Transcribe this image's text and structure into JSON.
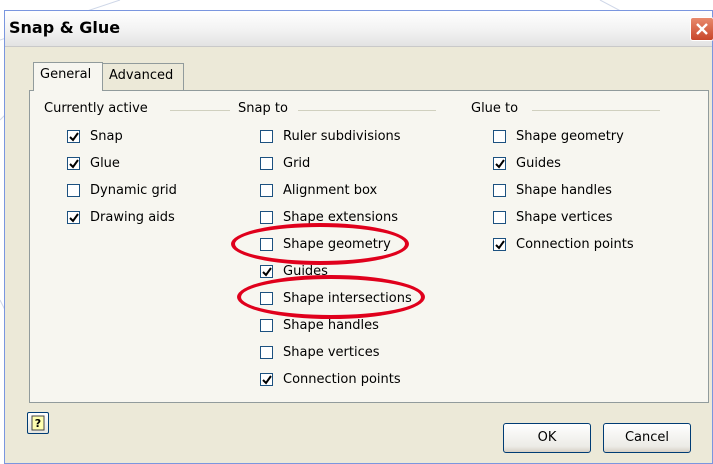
{
  "dialog": {
    "title": "Snap & Glue",
    "close_icon": "close-icon",
    "help_icon": "help-icon"
  },
  "tabs": [
    {
      "label": "General",
      "active": true
    },
    {
      "label": "Advanced",
      "active": false
    }
  ],
  "groups": {
    "currently_active": {
      "title": "Currently active",
      "items": [
        {
          "label": "Snap",
          "checked": true
        },
        {
          "label": "Glue",
          "checked": true
        },
        {
          "label": "Dynamic grid",
          "checked": false
        },
        {
          "label": "Drawing aids",
          "checked": true
        }
      ]
    },
    "snap_to": {
      "title": "Snap to",
      "items": [
        {
          "label": "Ruler subdivisions",
          "checked": false
        },
        {
          "label": "Grid",
          "checked": false
        },
        {
          "label": "Alignment box",
          "checked": false
        },
        {
          "label": "Shape extensions",
          "checked": false
        },
        {
          "label": "Shape geometry",
          "checked": false
        },
        {
          "label": "Guides",
          "checked": true
        },
        {
          "label": "Shape intersections",
          "checked": false
        },
        {
          "label": "Shape handles",
          "checked": false
        },
        {
          "label": "Shape vertices",
          "checked": false
        },
        {
          "label": "Connection points",
          "checked": true
        }
      ]
    },
    "glue_to": {
      "title": "Glue to",
      "items": [
        {
          "label": "Shape geometry",
          "checked": false
        },
        {
          "label": "Guides",
          "checked": true
        },
        {
          "label": "Shape handles",
          "checked": false
        },
        {
          "label": "Shape vertices",
          "checked": false
        },
        {
          "label": "Connection points",
          "checked": true
        }
      ]
    }
  },
  "buttons": {
    "ok": "OK",
    "cancel": "Cancel"
  },
  "annotation_color": "#e0001c"
}
